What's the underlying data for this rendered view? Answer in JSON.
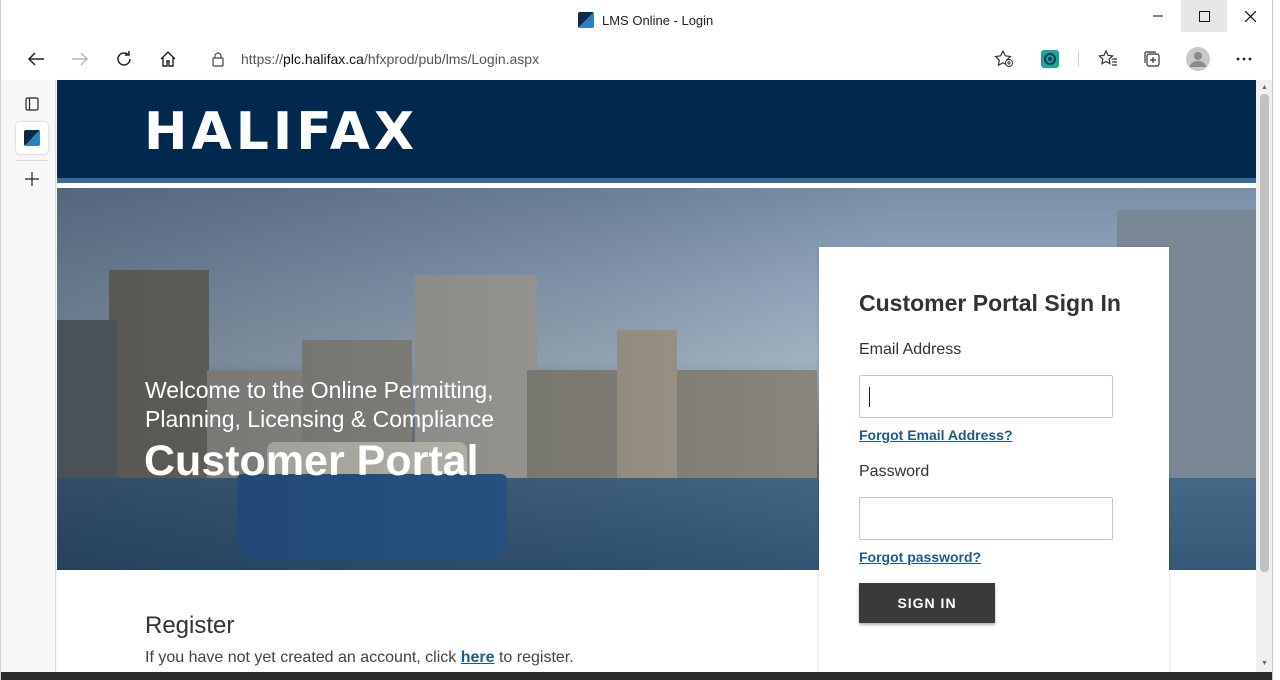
{
  "window": {
    "title": "LMS Online - Login"
  },
  "browser": {
    "url_prefix": "https://",
    "url_host": "plc.halifax.ca",
    "url_path": "/hfxprod/pub/lms/Login.aspx"
  },
  "site": {
    "logo_text": "HALIFAX",
    "welcome_line1": "Welcome to the Online Permitting,",
    "welcome_line2": "Planning, Licensing & Compliance",
    "portal_title": "Customer Portal"
  },
  "signin": {
    "heading": "Customer Portal Sign In",
    "email_label": "Email Address",
    "email_value": "",
    "forgot_email": "Forgot Email Address?",
    "password_label": "Password",
    "password_value": "",
    "forgot_password": "Forgot password?",
    "button_label": "SIGN IN"
  },
  "register": {
    "title": "Register",
    "text_before": "If you have not yet created an account, click ",
    "link": "here",
    "text_after": " to register."
  },
  "colors": {
    "header_navy": "#00294d",
    "link_blue": "#1d5a8f",
    "button_dark": "#3a3a3a"
  }
}
